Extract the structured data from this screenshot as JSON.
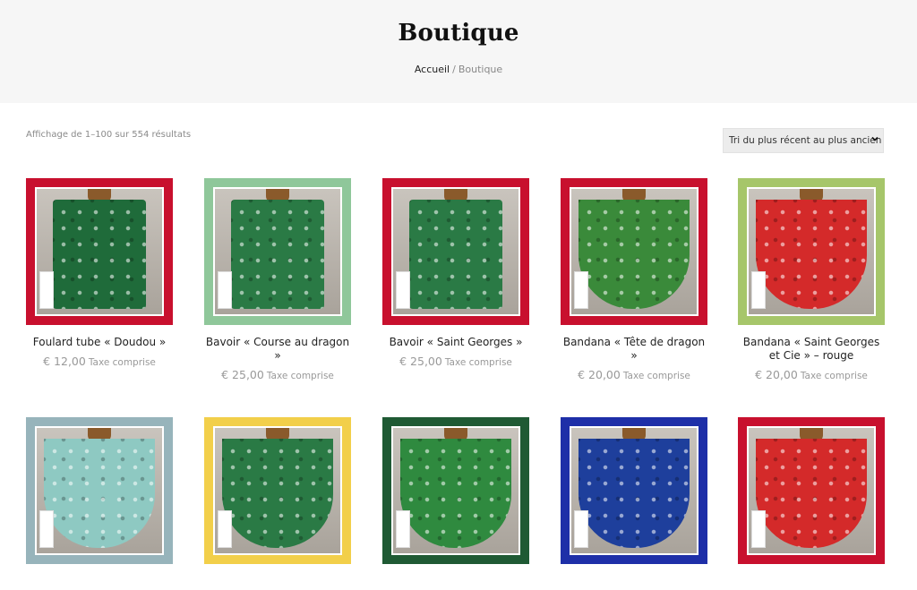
{
  "header": {
    "title": "Boutique",
    "breadcrumb_home": "Accueil",
    "breadcrumb_sep": "/",
    "breadcrumb_current": "Boutique"
  },
  "toolbar": {
    "result_count": "Affichage de 1–100 sur 554 résultats",
    "sort_selected": "Tri du plus récent au plus ancien"
  },
  "products": [
    {
      "title": "Foulard tube « Doudou »",
      "price": "€ 12,00",
      "tax": "Taxe comprise",
      "frame_color": "#c8102e",
      "fabric_color": "#1f6b3a"
    },
    {
      "title": "Bavoir « Course au dragon »",
      "price": "€ 25,00",
      "tax": "Taxe comprise",
      "frame_color": "#8fc79a",
      "fabric_color": "#2a7a45"
    },
    {
      "title": "Bavoir « Saint Georges »",
      "price": "€ 25,00",
      "tax": "Taxe comprise",
      "frame_color": "#c8102e",
      "fabric_color": "#2a7a45"
    },
    {
      "title": "Bandana « Tête de dragon »",
      "price": "€ 20,00",
      "tax": "Taxe comprise",
      "frame_color": "#c8102e",
      "fabric_color": "#3a8a3a"
    },
    {
      "title": "Bandana « Saint Georges et Cie » – rouge",
      "price": "€ 20,00",
      "tax": "Taxe comprise",
      "frame_color": "#a6c66a",
      "fabric_color": "#d42a2a"
    },
    {
      "title": "",
      "price": "",
      "tax": "",
      "frame_color": "#97b4bb",
      "fabric_color": "#8ec9c2"
    },
    {
      "title": "",
      "price": "",
      "tax": "",
      "frame_color": "#f2cf4a",
      "fabric_color": "#2a7a45"
    },
    {
      "title": "",
      "price": "",
      "tax": "",
      "frame_color": "#1f5a34",
      "fabric_color": "#2f8a3f"
    },
    {
      "title": "",
      "price": "",
      "tax": "",
      "frame_color": "#1e2fa8",
      "fabric_color": "#1e3f9c"
    },
    {
      "title": "",
      "price": "",
      "tax": "",
      "frame_color": "#c8102e",
      "fabric_color": "#d42a2a"
    }
  ]
}
